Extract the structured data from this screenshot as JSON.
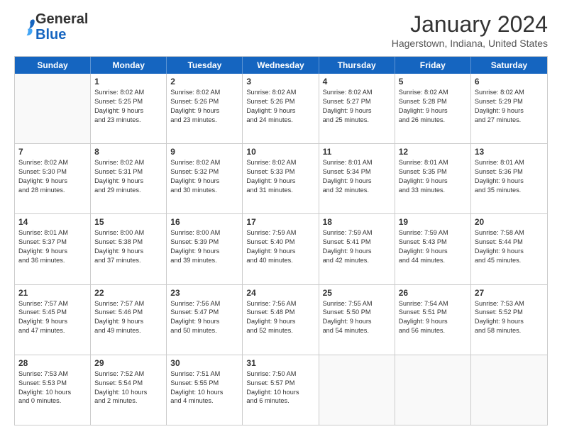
{
  "logo": {
    "general": "General",
    "blue": "Blue"
  },
  "title": "January 2024",
  "subtitle": "Hagerstown, Indiana, United States",
  "days_of_week": [
    "Sunday",
    "Monday",
    "Tuesday",
    "Wednesday",
    "Thursday",
    "Friday",
    "Saturday"
  ],
  "weeks": [
    [
      {
        "day": "",
        "lines": []
      },
      {
        "day": "1",
        "lines": [
          "Sunrise: 8:02 AM",
          "Sunset: 5:25 PM",
          "Daylight: 9 hours",
          "and 23 minutes."
        ]
      },
      {
        "day": "2",
        "lines": [
          "Sunrise: 8:02 AM",
          "Sunset: 5:26 PM",
          "Daylight: 9 hours",
          "and 23 minutes."
        ]
      },
      {
        "day": "3",
        "lines": [
          "Sunrise: 8:02 AM",
          "Sunset: 5:26 PM",
          "Daylight: 9 hours",
          "and 24 minutes."
        ]
      },
      {
        "day": "4",
        "lines": [
          "Sunrise: 8:02 AM",
          "Sunset: 5:27 PM",
          "Daylight: 9 hours",
          "and 25 minutes."
        ]
      },
      {
        "day": "5",
        "lines": [
          "Sunrise: 8:02 AM",
          "Sunset: 5:28 PM",
          "Daylight: 9 hours",
          "and 26 minutes."
        ]
      },
      {
        "day": "6",
        "lines": [
          "Sunrise: 8:02 AM",
          "Sunset: 5:29 PM",
          "Daylight: 9 hours",
          "and 27 minutes."
        ]
      }
    ],
    [
      {
        "day": "7",
        "lines": [
          "Sunrise: 8:02 AM",
          "Sunset: 5:30 PM",
          "Daylight: 9 hours",
          "and 28 minutes."
        ]
      },
      {
        "day": "8",
        "lines": [
          "Sunrise: 8:02 AM",
          "Sunset: 5:31 PM",
          "Daylight: 9 hours",
          "and 29 minutes."
        ]
      },
      {
        "day": "9",
        "lines": [
          "Sunrise: 8:02 AM",
          "Sunset: 5:32 PM",
          "Daylight: 9 hours",
          "and 30 minutes."
        ]
      },
      {
        "day": "10",
        "lines": [
          "Sunrise: 8:02 AM",
          "Sunset: 5:33 PM",
          "Daylight: 9 hours",
          "and 31 minutes."
        ]
      },
      {
        "day": "11",
        "lines": [
          "Sunrise: 8:01 AM",
          "Sunset: 5:34 PM",
          "Daylight: 9 hours",
          "and 32 minutes."
        ]
      },
      {
        "day": "12",
        "lines": [
          "Sunrise: 8:01 AM",
          "Sunset: 5:35 PM",
          "Daylight: 9 hours",
          "and 33 minutes."
        ]
      },
      {
        "day": "13",
        "lines": [
          "Sunrise: 8:01 AM",
          "Sunset: 5:36 PM",
          "Daylight: 9 hours",
          "and 35 minutes."
        ]
      }
    ],
    [
      {
        "day": "14",
        "lines": [
          "Sunrise: 8:01 AM",
          "Sunset: 5:37 PM",
          "Daylight: 9 hours",
          "and 36 minutes."
        ]
      },
      {
        "day": "15",
        "lines": [
          "Sunrise: 8:00 AM",
          "Sunset: 5:38 PM",
          "Daylight: 9 hours",
          "and 37 minutes."
        ]
      },
      {
        "day": "16",
        "lines": [
          "Sunrise: 8:00 AM",
          "Sunset: 5:39 PM",
          "Daylight: 9 hours",
          "and 39 minutes."
        ]
      },
      {
        "day": "17",
        "lines": [
          "Sunrise: 7:59 AM",
          "Sunset: 5:40 PM",
          "Daylight: 9 hours",
          "and 40 minutes."
        ]
      },
      {
        "day": "18",
        "lines": [
          "Sunrise: 7:59 AM",
          "Sunset: 5:41 PM",
          "Daylight: 9 hours",
          "and 42 minutes."
        ]
      },
      {
        "day": "19",
        "lines": [
          "Sunrise: 7:59 AM",
          "Sunset: 5:43 PM",
          "Daylight: 9 hours",
          "and 44 minutes."
        ]
      },
      {
        "day": "20",
        "lines": [
          "Sunrise: 7:58 AM",
          "Sunset: 5:44 PM",
          "Daylight: 9 hours",
          "and 45 minutes."
        ]
      }
    ],
    [
      {
        "day": "21",
        "lines": [
          "Sunrise: 7:57 AM",
          "Sunset: 5:45 PM",
          "Daylight: 9 hours",
          "and 47 minutes."
        ]
      },
      {
        "day": "22",
        "lines": [
          "Sunrise: 7:57 AM",
          "Sunset: 5:46 PM",
          "Daylight: 9 hours",
          "and 49 minutes."
        ]
      },
      {
        "day": "23",
        "lines": [
          "Sunrise: 7:56 AM",
          "Sunset: 5:47 PM",
          "Daylight: 9 hours",
          "and 50 minutes."
        ]
      },
      {
        "day": "24",
        "lines": [
          "Sunrise: 7:56 AM",
          "Sunset: 5:48 PM",
          "Daylight: 9 hours",
          "and 52 minutes."
        ]
      },
      {
        "day": "25",
        "lines": [
          "Sunrise: 7:55 AM",
          "Sunset: 5:50 PM",
          "Daylight: 9 hours",
          "and 54 minutes."
        ]
      },
      {
        "day": "26",
        "lines": [
          "Sunrise: 7:54 AM",
          "Sunset: 5:51 PM",
          "Daylight: 9 hours",
          "and 56 minutes."
        ]
      },
      {
        "day": "27",
        "lines": [
          "Sunrise: 7:53 AM",
          "Sunset: 5:52 PM",
          "Daylight: 9 hours",
          "and 58 minutes."
        ]
      }
    ],
    [
      {
        "day": "28",
        "lines": [
          "Sunrise: 7:53 AM",
          "Sunset: 5:53 PM",
          "Daylight: 10 hours",
          "and 0 minutes."
        ]
      },
      {
        "day": "29",
        "lines": [
          "Sunrise: 7:52 AM",
          "Sunset: 5:54 PM",
          "Daylight: 10 hours",
          "and 2 minutes."
        ]
      },
      {
        "day": "30",
        "lines": [
          "Sunrise: 7:51 AM",
          "Sunset: 5:55 PM",
          "Daylight: 10 hours",
          "and 4 minutes."
        ]
      },
      {
        "day": "31",
        "lines": [
          "Sunrise: 7:50 AM",
          "Sunset: 5:57 PM",
          "Daylight: 10 hours",
          "and 6 minutes."
        ]
      },
      {
        "day": "",
        "lines": []
      },
      {
        "day": "",
        "lines": []
      },
      {
        "day": "",
        "lines": []
      }
    ]
  ]
}
